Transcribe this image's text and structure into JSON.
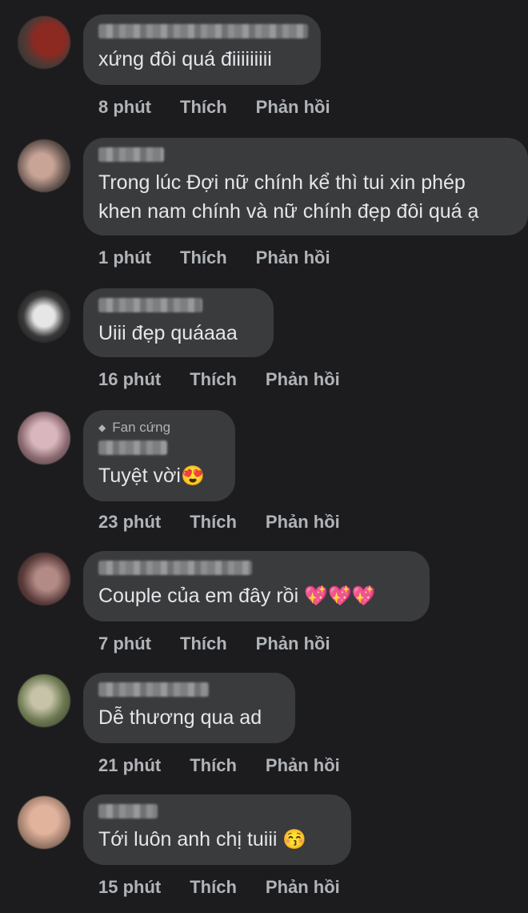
{
  "comments": [
    {
      "text": "xứng đôi quá điiiiiiiii",
      "time": "8 phút",
      "like": "Thích",
      "reply": "Phản hồi",
      "emoji": ""
    },
    {
      "text_lines": [
        "Trong lúc Đợi nữ chính kể thì tui xin phép",
        "khen nam chính và nữ chính đẹp đôi quá ạ"
      ],
      "time": "1 phút",
      "like": "Thích",
      "reply": "Phản hồi"
    },
    {
      "text": "Uiii đẹp quáaaa",
      "time": "16 phút",
      "like": "Thích",
      "reply": "Phản hồi",
      "emoji": ""
    },
    {
      "badge": "Fan cứng",
      "text": "Tuyệt vời",
      "emoji": "😍",
      "time": "23 phút",
      "like": "Thích",
      "reply": "Phản hồi"
    },
    {
      "text": "Couple của em đây rồi ",
      "emoji": "💖💖💖",
      "time": "7 phút",
      "like": "Thích",
      "reply": "Phản hồi"
    },
    {
      "text": "Dễ thương qua ad",
      "time": "21 phút",
      "like": "Thích",
      "reply": "Phản hồi",
      "emoji": ""
    },
    {
      "text": "Tới luôn anh chị tuiii ",
      "emoji": "😚",
      "time": "15 phút",
      "like": "Thích",
      "reply": "Phản hồi"
    }
  ],
  "colors": {
    "background": "#1c1c1e",
    "bubble": "#3a3b3c",
    "text": "#e4e6eb",
    "meta": "#b0b3b8"
  }
}
